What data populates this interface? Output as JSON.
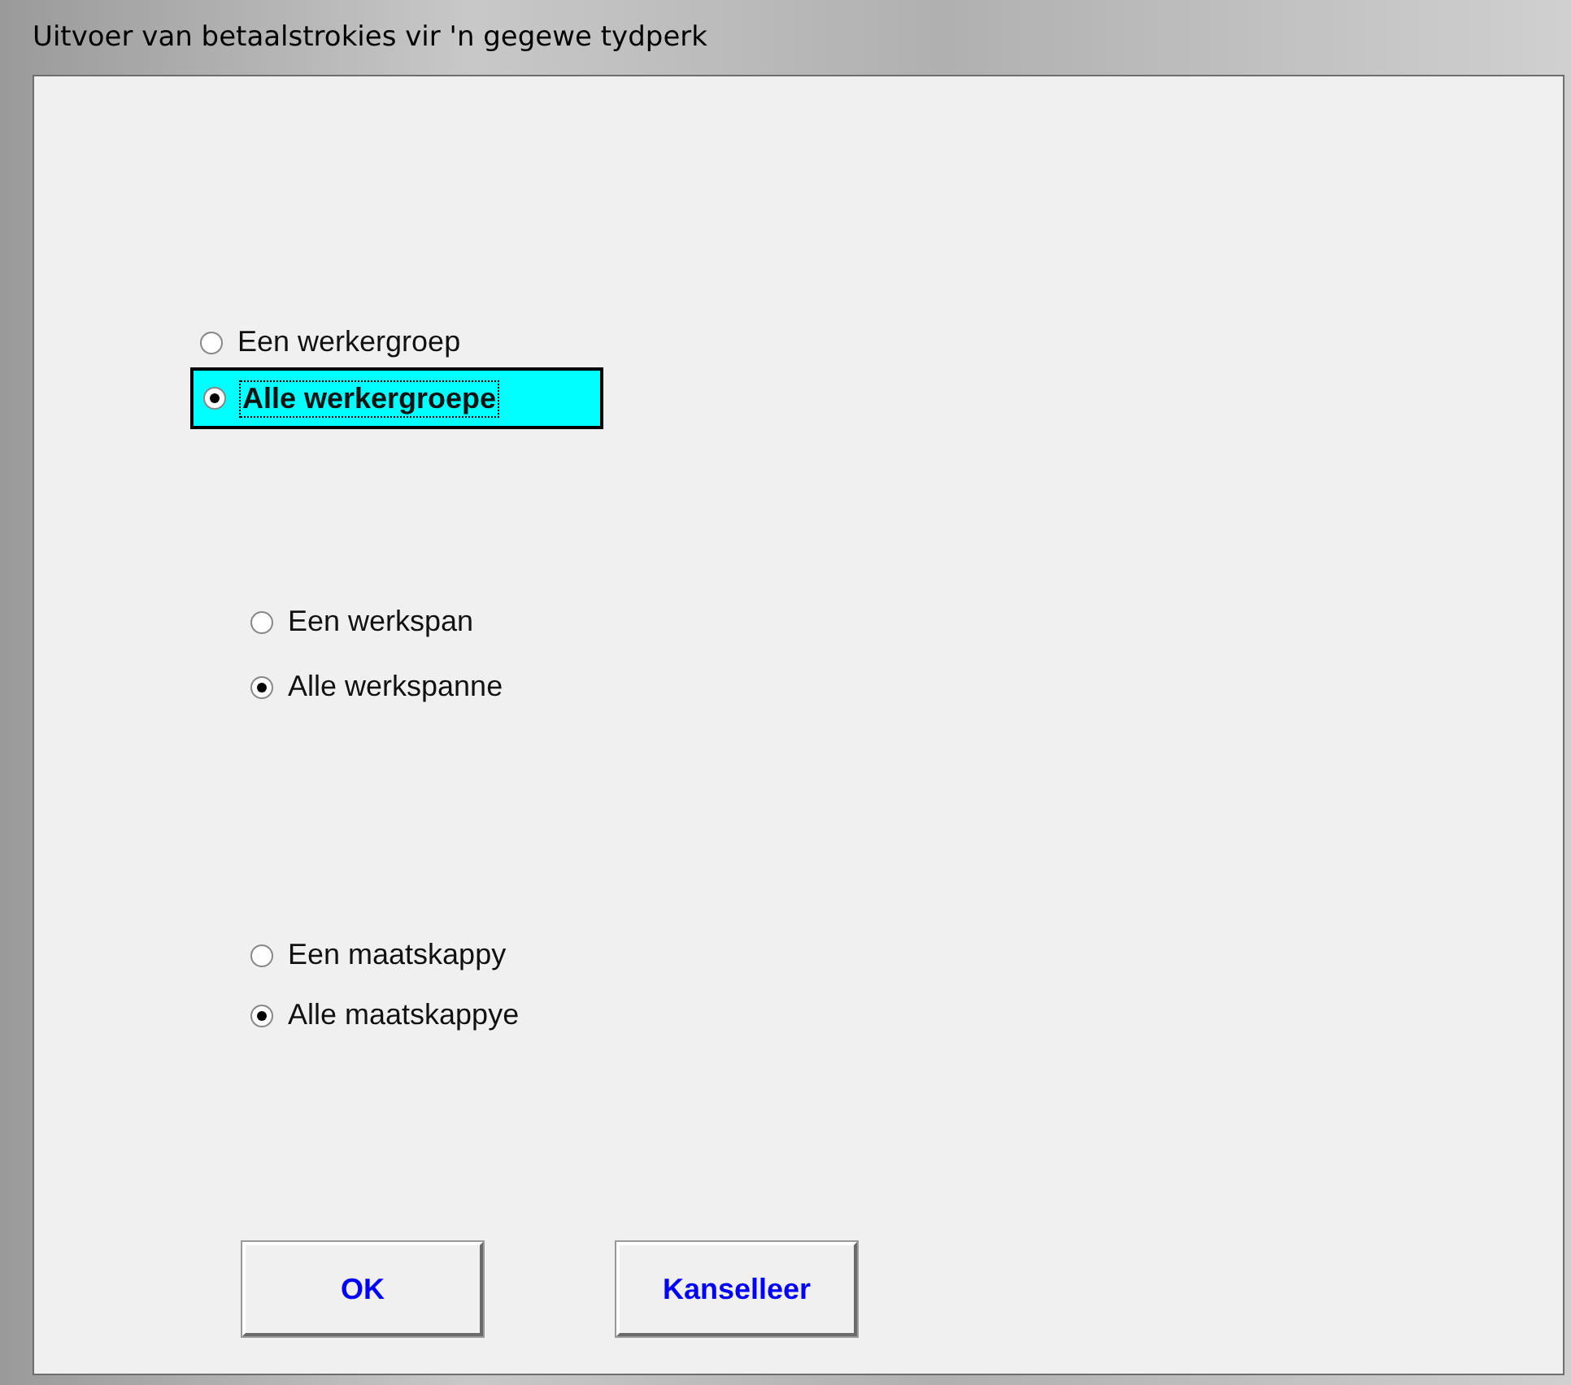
{
  "window": {
    "title": "Uitvoer van betaalstrokies vir 'n gegewe tydperk"
  },
  "groups": [
    {
      "options": [
        {
          "label": "Een werkergroep",
          "selected": false,
          "focused": false
        },
        {
          "label": "Alle werkergroepe",
          "selected": true,
          "focused": true
        }
      ]
    },
    {
      "options": [
        {
          "label": "Een werkspan",
          "selected": false,
          "focused": false
        },
        {
          "label": "Alle werkspanne",
          "selected": true,
          "focused": false
        }
      ]
    },
    {
      "options": [
        {
          "label": "Een maatskappy",
          "selected": false,
          "focused": false
        },
        {
          "label": "Alle maatskappye",
          "selected": true,
          "focused": false
        }
      ]
    }
  ],
  "buttons": [
    "OK",
    "Kanselleer"
  ]
}
